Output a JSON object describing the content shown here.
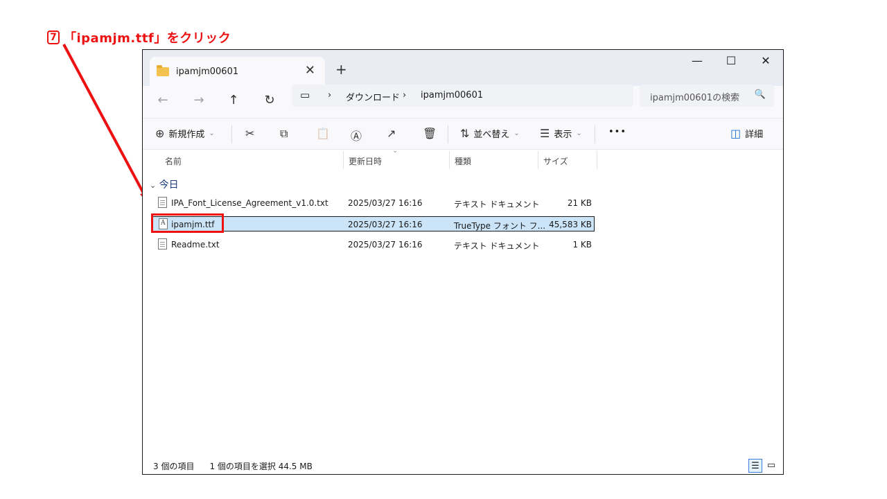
{
  "annotation": {
    "step_number": "7",
    "instruction": "「ipamjm.ttf」をクリック"
  },
  "window": {
    "tab_title": "ipamjm00601",
    "tab_close": "✕",
    "tab_new": "+",
    "controls": {
      "minimize": "—",
      "maximize": "☐",
      "close": "✕"
    }
  },
  "nav": {
    "back": "←",
    "forward": "→",
    "up": "↑",
    "refresh": "↻",
    "address": {
      "root_icon": "▭",
      "sep": "›",
      "parts": [
        "ダウンロード",
        "ipamjm00601"
      ]
    },
    "search": {
      "placeholder": "ipamjm00601の検索",
      "icon": "🔍"
    }
  },
  "toolbar": {
    "new_icon": "⊕",
    "new_label": "新規作成",
    "new_chevron": "⌄",
    "cut": "✂",
    "copy": "⧉",
    "paste": "📋",
    "rename": "Ⓐ",
    "share": "↗",
    "delete": "🗑",
    "sort_icon": "⇅",
    "sort_label": "並べ替え",
    "sort_chevron": "⌄",
    "view_icon": "☰",
    "view_label": "表示",
    "view_chevron": "⌄",
    "more": "•••",
    "details_icon": "◫",
    "details_label": "詳細"
  },
  "columns": {
    "name": "名前",
    "date": "更新日時",
    "type": "種類",
    "size": "サイズ",
    "sort_indicator": "⌄"
  },
  "group": {
    "chevron": "⌄",
    "label": "今日"
  },
  "files": [
    {
      "name": "IPA_Font_License_Agreement_v1.0.txt",
      "date": "2025/03/27 16:16",
      "type": "テキスト ドキュメント",
      "size": "21 KB",
      "icon": "text-file-icon"
    },
    {
      "name": "ipamjm.ttf",
      "date": "2025/03/27 16:16",
      "type": "TrueType フォント フ...",
      "size": "45,583 KB",
      "icon": "font-file-icon",
      "selected": true
    },
    {
      "name": "Readme.txt",
      "date": "2025/03/27 16:16",
      "type": "テキスト ドキュメント",
      "size": "1 KB",
      "icon": "text-file-icon"
    }
  ],
  "font_icon_letter": "A",
  "status": {
    "count": "3 個の項目",
    "selection": "1 個の項目を選択  44.5 MB"
  },
  "view_buttons": {
    "details": "☰",
    "tiles": "▭"
  },
  "colors": {
    "annotation": "#ee1111",
    "selection": "#cce4f7"
  }
}
